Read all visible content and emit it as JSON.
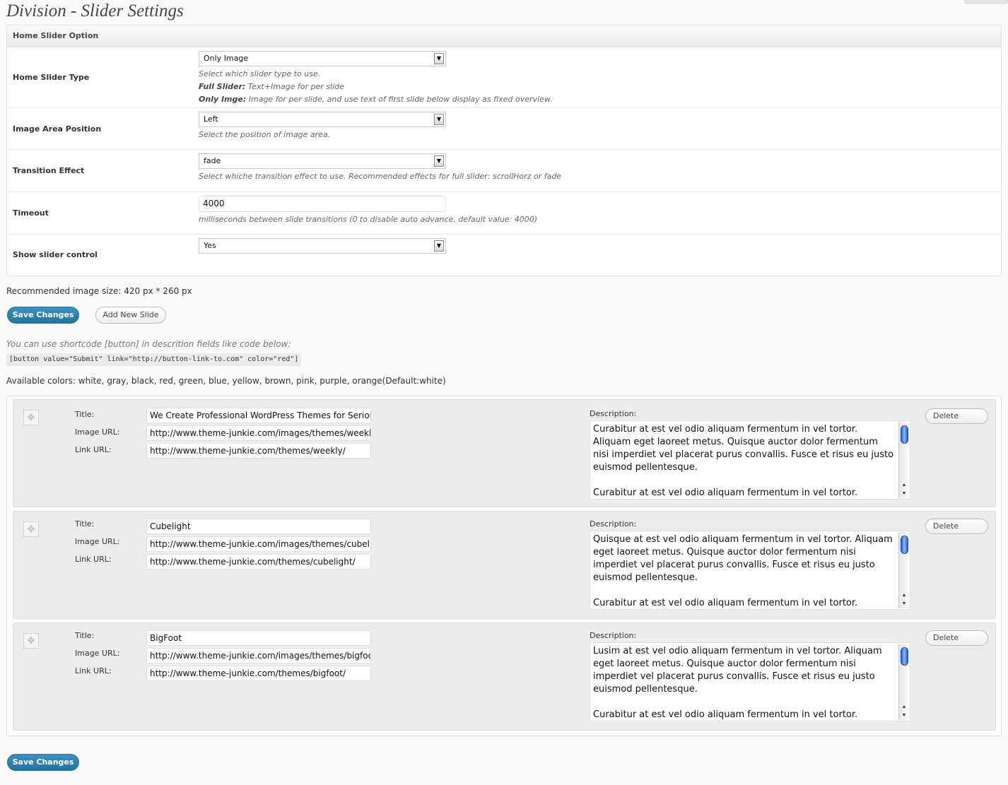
{
  "page": {
    "title": "Division - Slider Settings"
  },
  "options_panel": {
    "header": "Home Slider Option",
    "slider_type": {
      "label": "Home Slider Type",
      "value": "Only Image",
      "desc_line1": "Select which slider type to use.",
      "full_label": "Full Slider:",
      "full_text": "Text+Image for per slide",
      "only_label": "Only Imge:",
      "only_text": "Image for per slide, and use text of first slide below display as fixed overview."
    },
    "image_position": {
      "label": "Image Area Position",
      "value": "Left",
      "desc": "Select the position of image area."
    },
    "transition": {
      "label": "Transition Effect",
      "value": "fade",
      "desc": "Select whiche transition effect to use. Recommended effects for full slider: scrollHorz or fade"
    },
    "timeout": {
      "label": "Timeout",
      "value": "4000",
      "desc": "milliseconds between slide transitions (0 to disable auto advance, default value: 4000)"
    },
    "slider_control": {
      "label": "Show slider control",
      "value": "Yes"
    }
  },
  "recommended_size": "Recommended image size: 420 px * 260 px",
  "buttons": {
    "save": "Save Changes",
    "add_slide": "Add New Slide"
  },
  "shortcode_hint": "You can use shortcode [button] in descrition fields like code below:",
  "shortcode_example": "[button value=\"Submit\" link=\"http://button-link-to.com\" color=\"red\"]",
  "available_colors": "Available colors: white, gray, black, red, green, blue, yellow, brown, pink, purple, orange(Default:white)",
  "slide_labels": {
    "title": "Title:",
    "image_url": "Image URL:",
    "link_url": "Link URL:",
    "description": "Description:",
    "delete": "Delete"
  },
  "slides": [
    {
      "title": "We Create Professional WordPress Themes for Serious",
      "image_url": "http://www.theme-junkie.com/images/themes/weekly",
      "link_url": "http://www.theme-junkie.com/themes/weekly/",
      "desc_first_word": "Curabitur",
      "desc_body": "Curabitur at est vel odio aliquam fermentum in vel tortor. Aliquam eget laoreet metus. Quisque auctor dolor fermentum nisi imperdiet vel placerat purus convallis. Fusce et risus eu justo euismod pellentesque.",
      "desc_second_para": "Curabitur at est vel odio aliquam fermentum in vel tortor. Aliquam"
    },
    {
      "title": "Cubelight",
      "image_url": "http://www.theme-junkie.com/images/themes/cubelight",
      "link_url": "http://www.theme-junkie.com/themes/cubelight/",
      "desc_first_word": "Quisque",
      "desc_body": "Quisque at est vel odio aliquam fermentum in vel tortor. Aliquam eget laoreet metus. Quisque auctor dolor fermentum nisi imperdiet vel placerat purus convallis. Fusce et risus eu justo euismod pellentesque.",
      "desc_second_para": "Curabitur at est vel odio aliquam fermentum in vel tortor. Aliquam"
    },
    {
      "title": "BigFoot",
      "image_url": "http://www.theme-junkie.com/images/themes/bigfoot",
      "link_url": "http://www.theme-junkie.com/themes/bigfoot/",
      "desc_first_word": "Lusim",
      "desc_body": "Lusim at est vel odio aliquam fermentum in vel tortor. Aliquam eget laoreet metus. Quisque auctor dolor fermentum nisi imperdiet vel placerat purus convallis. Fusce et risus eu justo euismod pellentesque.",
      "desc_second_para": "Curabitur at est vel odio aliquam fermentum in vel tortor. Aliquam"
    }
  ],
  "colors": {
    "primary_button": "#21759b",
    "background": "#f9f9f9",
    "spellcheck": "#dd0000"
  }
}
